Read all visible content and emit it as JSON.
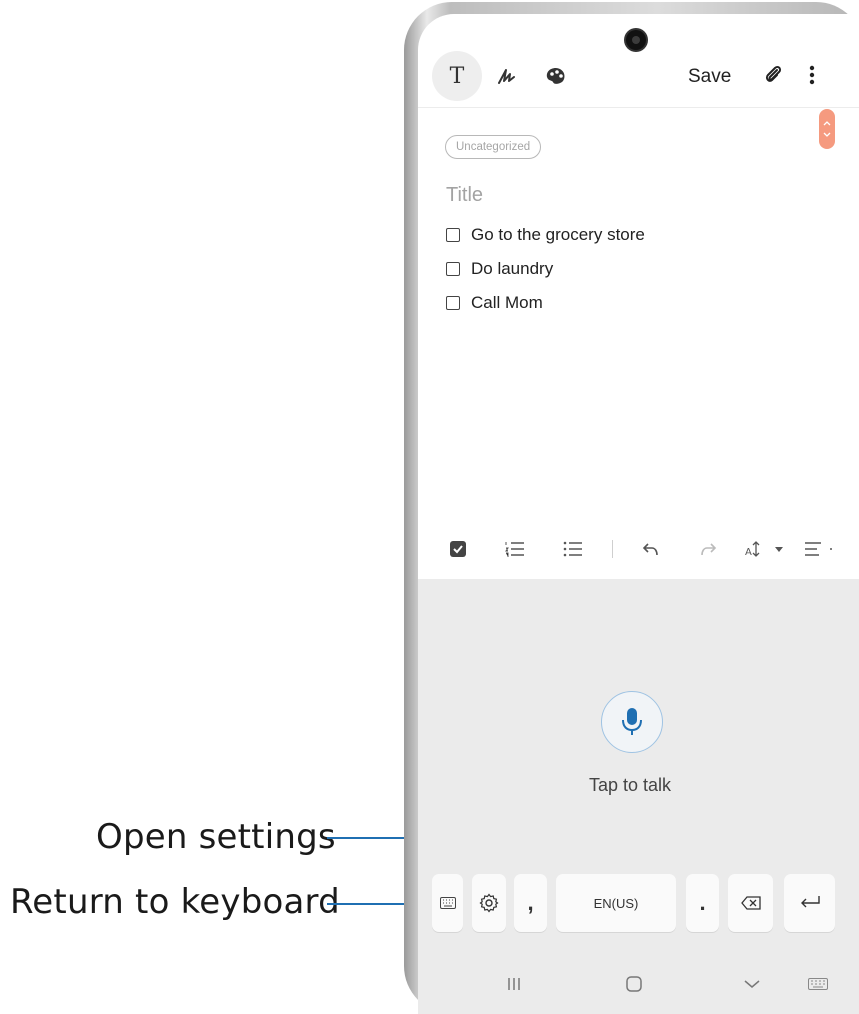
{
  "callouts": {
    "open_settings": "Open settings",
    "return_keyboard": "Return to keyboard"
  },
  "toolbar": {
    "mode_text": "T",
    "save_label": "Save"
  },
  "note": {
    "category": "Uncategorized",
    "title_placeholder": "Title",
    "checklist": [
      {
        "text": "Go to the grocery store",
        "checked": false
      },
      {
        "text": "Do laundry",
        "checked": false
      },
      {
        "text": "Call Mom",
        "checked": false
      }
    ]
  },
  "voice": {
    "tap_label": "Tap to talk"
  },
  "keyboard_row": {
    "comma": ",",
    "space_label": "EN(US)",
    "period": "."
  },
  "colors": {
    "accent": "#1f6fb2",
    "scroll_thumb": "#f59a7f",
    "panel": "#ebebeb"
  }
}
